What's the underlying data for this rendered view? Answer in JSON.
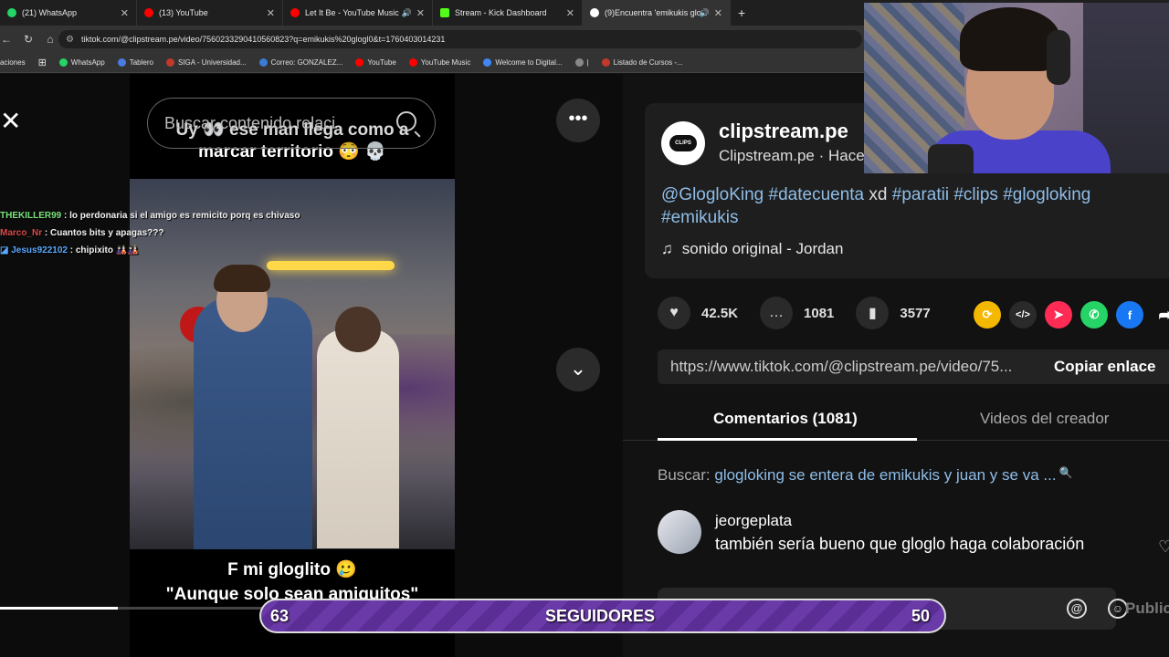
{
  "browser": {
    "tabs": [
      {
        "label": "(21) WhatsApp",
        "color": "#25d366"
      },
      {
        "label": "(13) YouTube",
        "color": "#ff0000"
      },
      {
        "label": "Let It Be - YouTube Music",
        "color": "#ff0000"
      },
      {
        "label": "Stream - Kick Dashboard",
        "color": "#53fc18"
      },
      {
        "label": "(9)Encuentra 'emikukis glo",
        "color": "#ffffff"
      }
    ],
    "url": "tiktok.com/@clipstream.pe/video/7560233290410560823?q=emikukis%20glogl0&t=1760403014231"
  },
  "bookmarks": [
    {
      "label": "aciones",
      "color": ""
    },
    {
      "label": "WhatsApp",
      "color": "#25d366"
    },
    {
      "label": "Tablero",
      "color": "#4a7be0"
    },
    {
      "label": "SIGA - Universidad...",
      "color": "#c0392b"
    },
    {
      "label": "Correo: GONZALEZ...",
      "color": "#3a7bd5"
    },
    {
      "label": "YouTube",
      "color": "#ff0000"
    },
    {
      "label": "YouTube Music",
      "color": "#ff0000"
    },
    {
      "label": "Welcome to Digital...",
      "color": "#4285f4"
    },
    {
      "label": "|",
      "color": "#888888"
    },
    {
      "label": "Listado de Cursos -...",
      "color": "#c0392b"
    }
  ],
  "video": {
    "search_placeholder": "Buscar contenido relaci",
    "top_caption_line1": "Uy 👀 ese man llega como a",
    "top_caption_line2": "marcar territorio 😳 💀",
    "bottom_caption_line1": "F mi gloglito 🥲",
    "bottom_caption_line2": "\"Aunque solo sean amiguitos\"",
    "progress_fraction": 0.43
  },
  "chat": [
    {
      "user": "THEKILLER99",
      "color": "#7be37b",
      "text": " : lo perdonaria si el amigo es remicito porq es chivaso"
    },
    {
      "user": "Marco_Nr",
      "color": "#d94a4a",
      "text": " : Cuantos bits y apagas???"
    },
    {
      "user": "Jesus922102",
      "color": "#5aa8ff",
      "text": " : chipixito 🎎🎎"
    }
  ],
  "post": {
    "avatar_text": "CLIPS",
    "handle": "clipstream.pe",
    "subname": "Clipstream.pe · Hace",
    "description_parts": [
      {
        "text": "@GlogloKing",
        "tag": true
      },
      {
        "text": " ",
        "tag": false
      },
      {
        "text": "#datecuenta",
        "tag": true
      },
      {
        "text": " xd ",
        "tag": false
      },
      {
        "text": "#paratii",
        "tag": true
      },
      {
        "text": " ",
        "tag": false
      },
      {
        "text": "#clips",
        "tag": true
      },
      {
        "text": " ",
        "tag": false
      },
      {
        "text": "#glogloking",
        "tag": true
      },
      {
        "text": " ",
        "tag": false
      },
      {
        "text": "#emikukis",
        "tag": true
      }
    ],
    "sound": "sonido original - Jordan",
    "likes": "42.5K",
    "comments": "1081",
    "saves": "3577",
    "link": "https://www.tiktok.com/@clipstream.pe/video/75...",
    "copy_label": "Copiar enlace"
  },
  "panel_tabs": {
    "comments": "Comentarios (1081)",
    "creator_videos": "Videos del creador"
  },
  "search": {
    "label": "Buscar: ",
    "query": "glogloking se entera de emikukis y juan y se va ..."
  },
  "comment": {
    "user": "jeorgeplata",
    "text": "también sería bueno que gloglo haga colaboración"
  },
  "publish_label": "Publicar",
  "followers_bar": {
    "left_value": "63",
    "label": "SEGUIDORES",
    "right_value": "50"
  },
  "share_colors": {
    "repost": "#f5b800",
    "embed": "#2a2a2a",
    "send": "#fe2c55",
    "whatsapp": "#25d366",
    "facebook": "#1877f2"
  }
}
